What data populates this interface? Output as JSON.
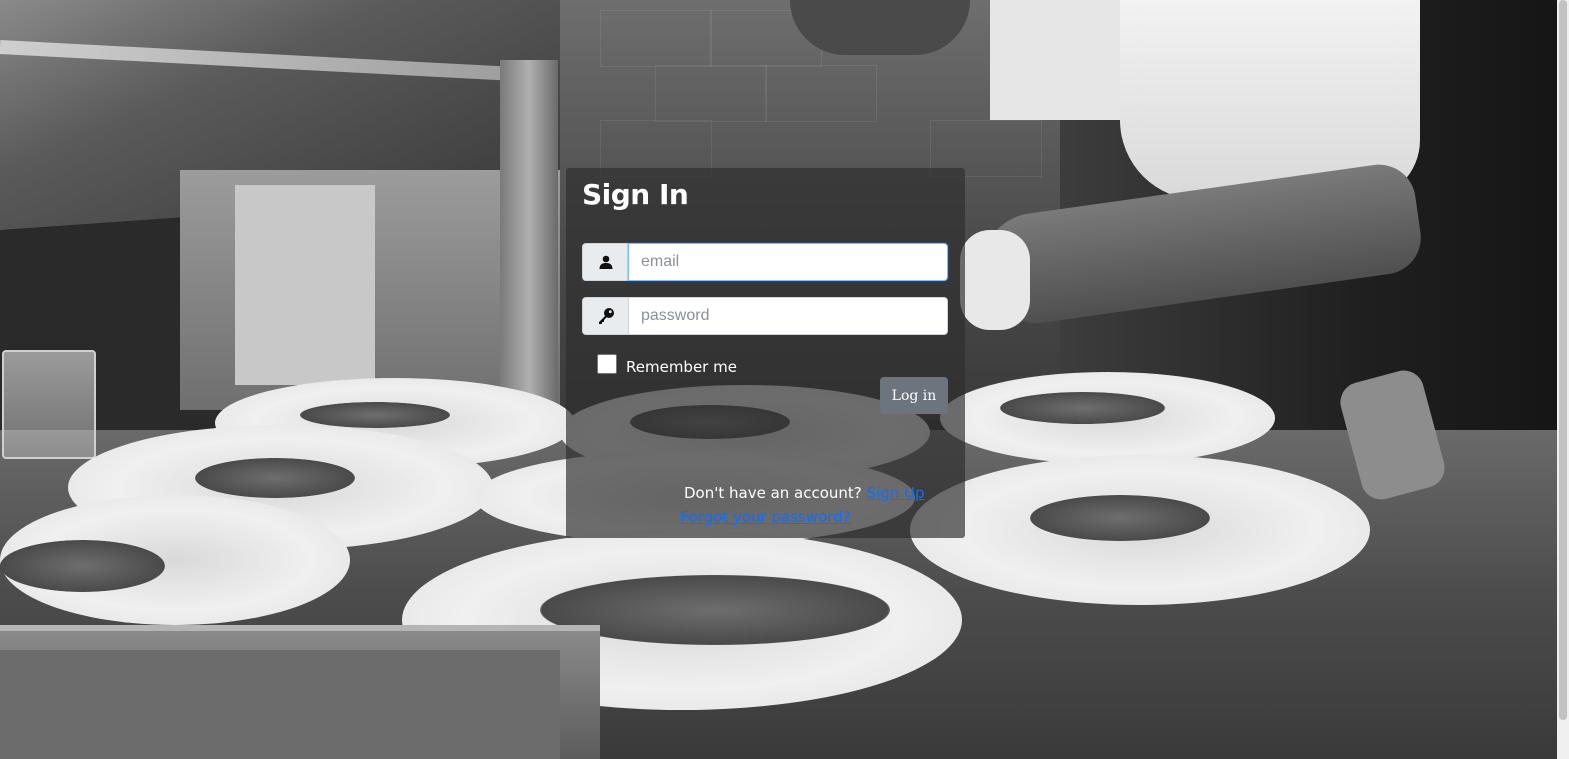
{
  "signin": {
    "title": "Sign In",
    "email": {
      "placeholder": "email",
      "value": "",
      "icon": "user-icon"
    },
    "password": {
      "placeholder": "password",
      "value": "",
      "icon": "key-icon"
    },
    "remember_label": "Remember me",
    "remember_checked": false,
    "login_label": "Log in",
    "signup_prompt": "Don't have an account?",
    "signup_link": "Sign Up",
    "forgot_link": "Forgot your password?"
  },
  "colors": {
    "panel_bg": "#2d2d2dAD",
    "link": "#0d6efd",
    "button": "#6c757d",
    "input_focus_border": "#80bdff"
  }
}
